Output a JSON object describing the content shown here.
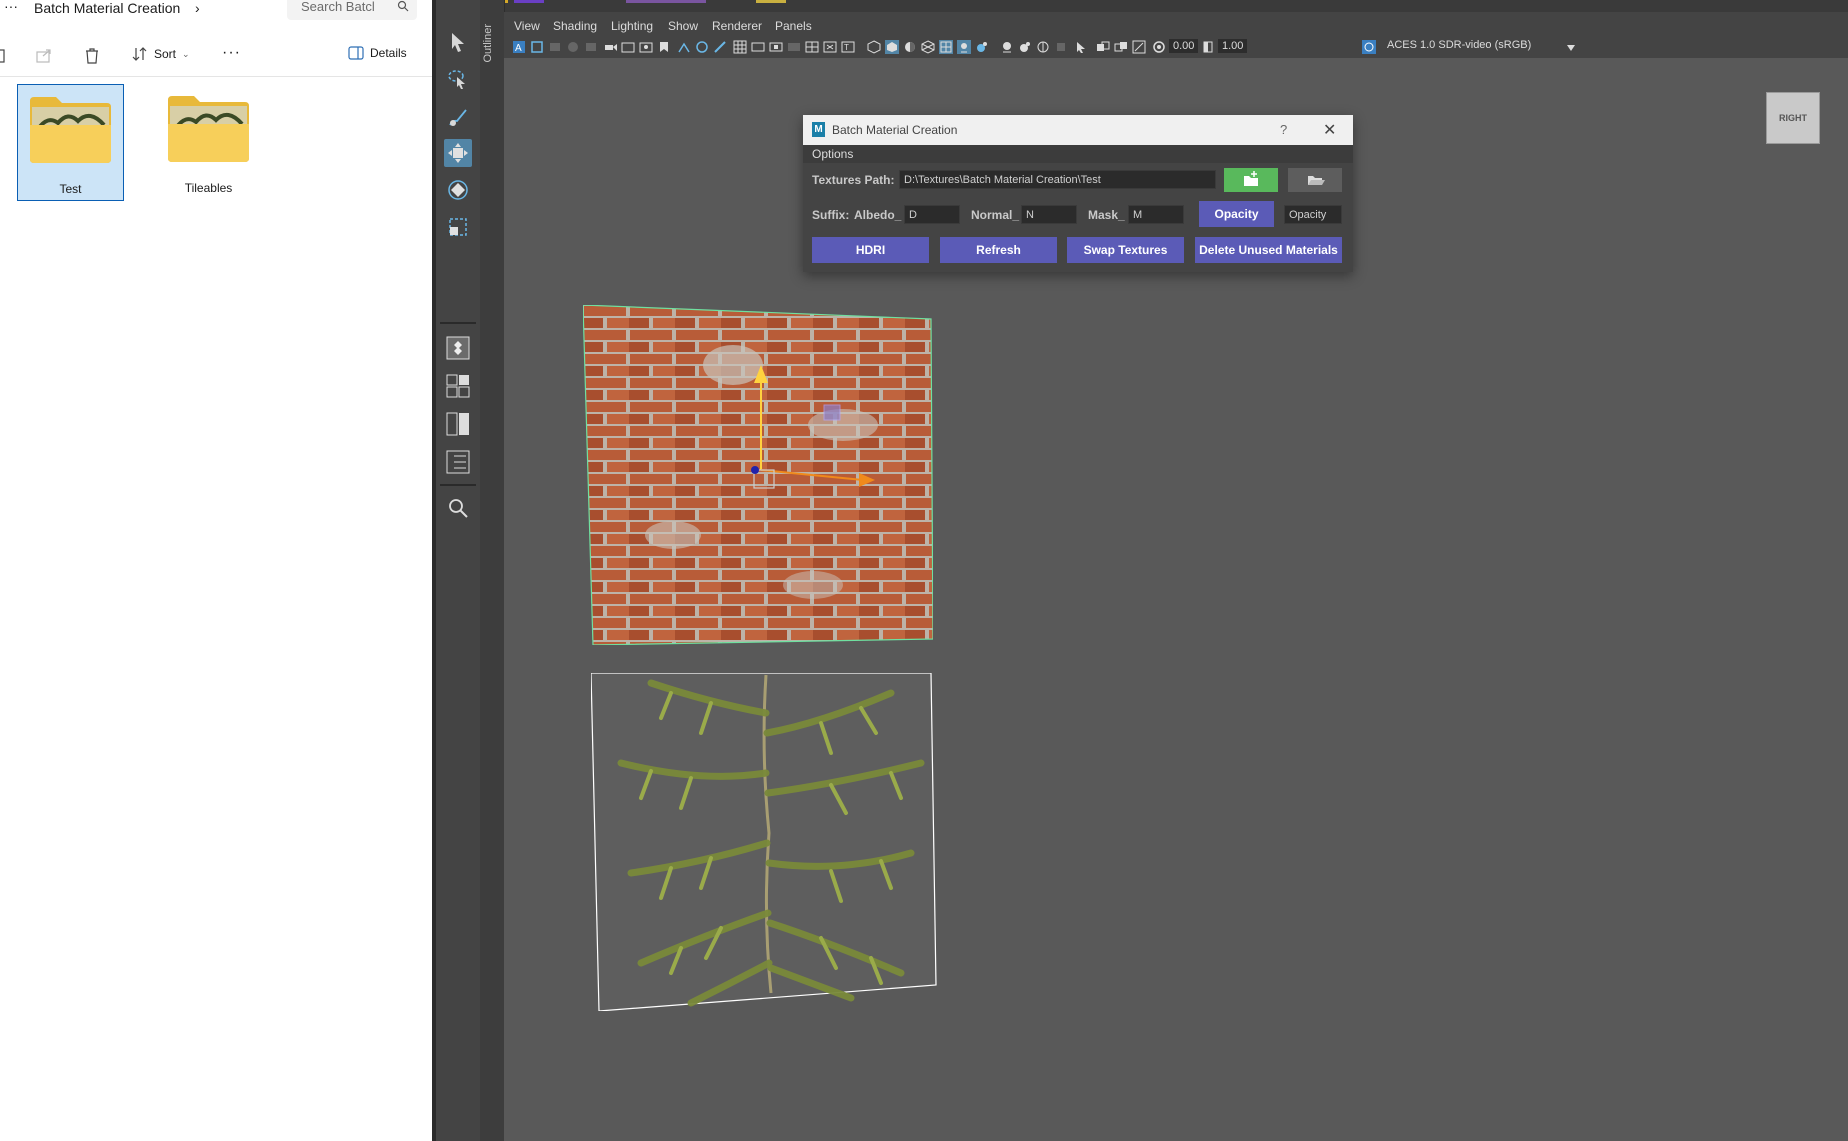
{
  "explorer": {
    "breadcrumb": "Batch Material Creation",
    "breadcrumb_chevron": "›",
    "top_dots": "···",
    "search_placeholder": "Search Batcl",
    "toolbar": {
      "sort_label": "Sort",
      "more_label": "···",
      "details_label": "Details"
    },
    "folders": [
      {
        "label": "Test",
        "selected": true
      },
      {
        "label": "Tileables",
        "selected": false
      }
    ]
  },
  "maya": {
    "outliner_label": "Outliner",
    "menus": [
      "View",
      "Shading",
      "Lighting",
      "Show",
      "Renderer",
      "Panels"
    ],
    "exposure_value": "0.00",
    "gamma_value": "1.00",
    "color_space": "ACES 1.0 SDR-video (sRGB)",
    "viewcube_label": "RIGHT",
    "accent_color": "#5285a6"
  },
  "dialog": {
    "title": "Batch Material Creation",
    "help_label": "?",
    "close_label": "✕",
    "menu_options": "Options",
    "textures_path_label": "Textures Path:",
    "textures_path_value": "D:\\Textures\\Batch Material Creation\\Test",
    "suffix_label": "Suffix:",
    "albedo_label": "Albedo_",
    "albedo_value": "D",
    "normal_label": "Normal_",
    "normal_value": "N",
    "mask_label": "Mask_",
    "mask_value": "M",
    "opacity_button": "Opacity",
    "opacity_value": "Opacity",
    "buttons": {
      "hdri": "HDRI",
      "refresh": "Refresh",
      "swap": "Swap Textures",
      "delete_unused": "Delete Unused Materials"
    },
    "button_color": "#5b5bb7",
    "new_folder_color": "#59b95c"
  }
}
